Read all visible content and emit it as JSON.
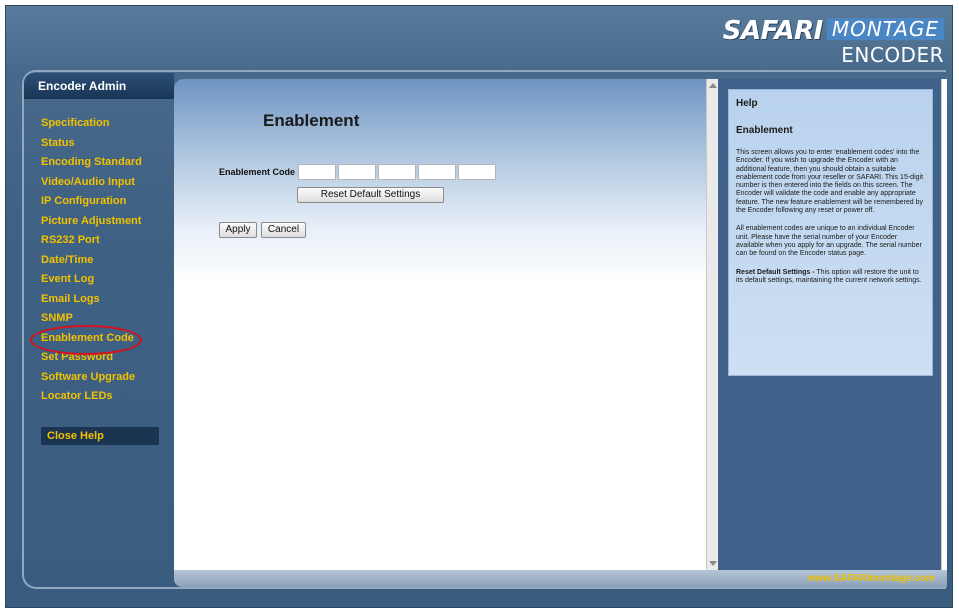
{
  "brand": {
    "word1": "SAFARI",
    "word2": "MONTAGE",
    "word3": "ENCODER"
  },
  "admin_tab": "Encoder Admin",
  "nav": {
    "items": [
      {
        "label": "Specification"
      },
      {
        "label": "Status"
      },
      {
        "label": "Encoding Standard"
      },
      {
        "label": "Video/Audio Input"
      },
      {
        "label": "IP Configuration"
      },
      {
        "label": "Picture Adjustment"
      },
      {
        "label": "RS232 Port"
      },
      {
        "label": "Date/Time"
      },
      {
        "label": "Event Log"
      },
      {
        "label": "Email Logs"
      },
      {
        "label": "SNMP"
      },
      {
        "label": "Enablement Code",
        "highlighted": true
      },
      {
        "label": "Set Password"
      },
      {
        "label": "Software Upgrade"
      },
      {
        "label": "Locator LEDs"
      }
    ],
    "close_help": "Close Help"
  },
  "main": {
    "title": "Enablement",
    "code_label": "Enablement Code",
    "code_fields": [
      "",
      "",
      "",
      "",
      ""
    ],
    "reset_button": "Reset Default Settings",
    "apply_button": "Apply",
    "cancel_button": "Cancel"
  },
  "help": {
    "title": "Help",
    "subtitle": "Enablement",
    "p1": "This screen allows you to enter 'enablement codes' into the Encoder. If you wish to upgrade the Encoder with an additional feature, then you should obtain a suitable enablement code from your reseller or SAFARI. This 15-digit number is then entered into the fields on this screen. The Encoder will validate the code and enable any appropriate feature. The new feature enablement will be remembered by the Encoder following any reset or power off.",
    "p2": "All enablement codes are unique to an individual Encoder unit. Please have the serial number of your Encoder available when you apply for an upgrade. The serial number can be found on the Encoder status page.",
    "p3_bold": "Reset Default Settings -",
    "p3": " This option will restore the unit to its default settings, maintaining the current network settings."
  },
  "footer": {
    "url": "www.SAFARImontage.com"
  },
  "colors": {
    "nav_text": "#f2c200",
    "highlight_ring": "#d8101c",
    "frame_blue": "#3f6183"
  }
}
